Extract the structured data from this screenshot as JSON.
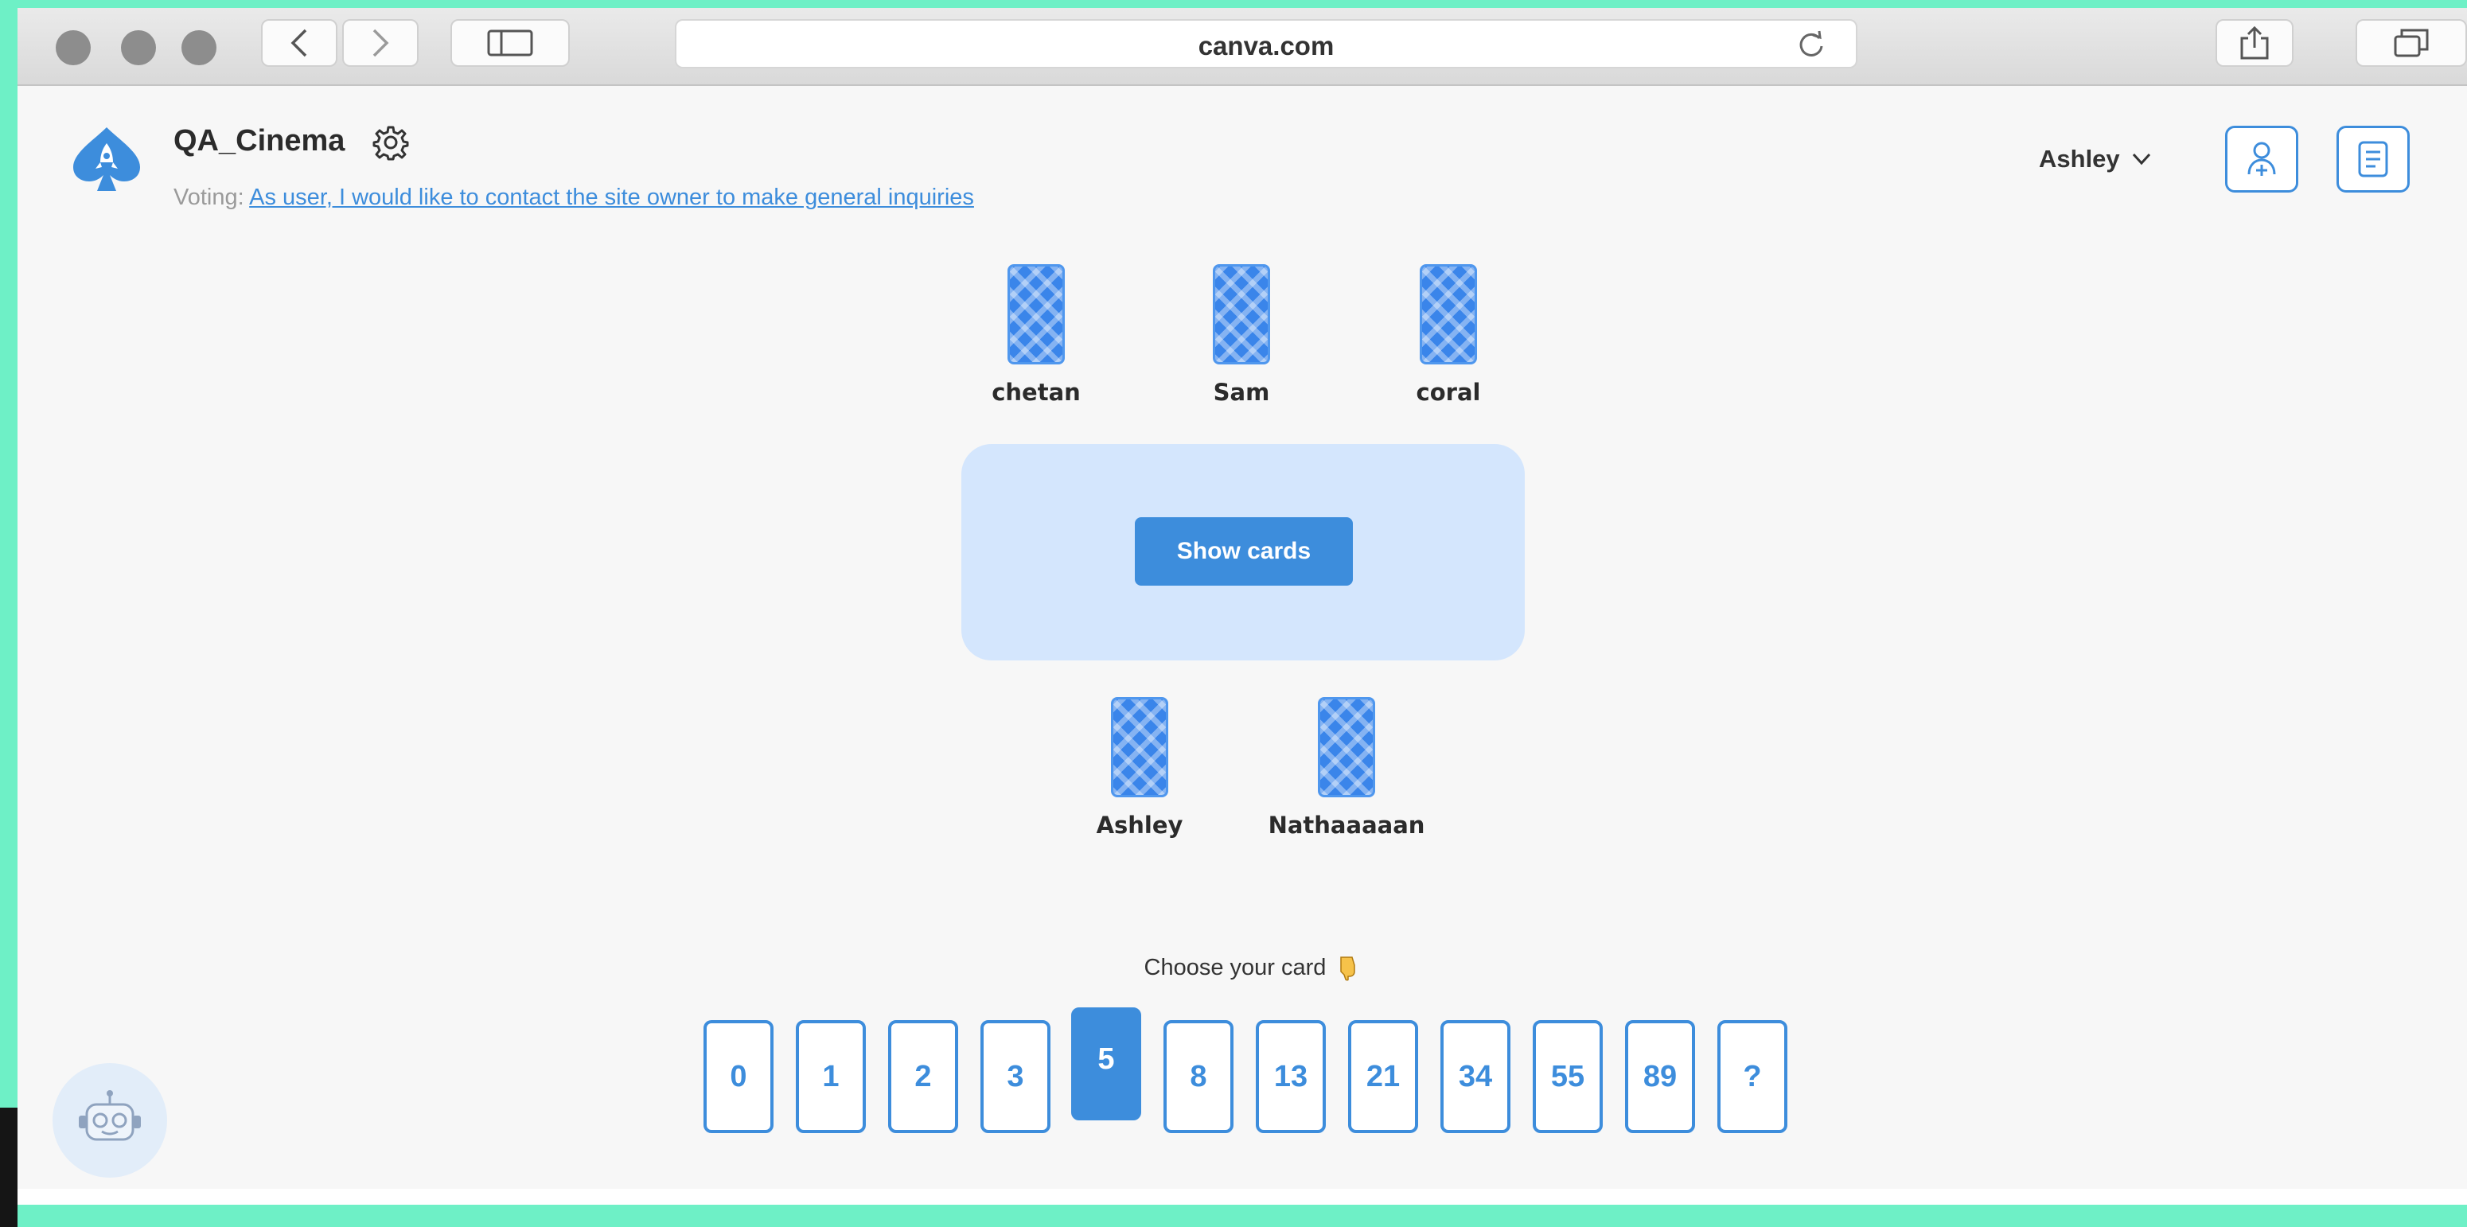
{
  "browser": {
    "url": "canva.com"
  },
  "app": {
    "room_name": "QA_Cinema",
    "voting_prefix": "Voting:",
    "voting_story": "As user, I would like to contact the site owner to make general inquiries",
    "user_name": "Ashley"
  },
  "players": [
    {
      "name": "chetan"
    },
    {
      "name": "Sam"
    },
    {
      "name": "coral"
    },
    {
      "name": "Ashley"
    },
    {
      "name": "Nathaaaaan"
    }
  ],
  "table": {
    "button_label": "Show cards"
  },
  "deck": {
    "prompt": "Choose your card",
    "cards": [
      "0",
      "1",
      "2",
      "3",
      "5",
      "8",
      "13",
      "21",
      "34",
      "55",
      "89",
      "?"
    ],
    "selected": "5"
  },
  "colors": {
    "accent": "#3d8ddc",
    "table": "#d4e6fd",
    "background": "#f7f7f7"
  }
}
